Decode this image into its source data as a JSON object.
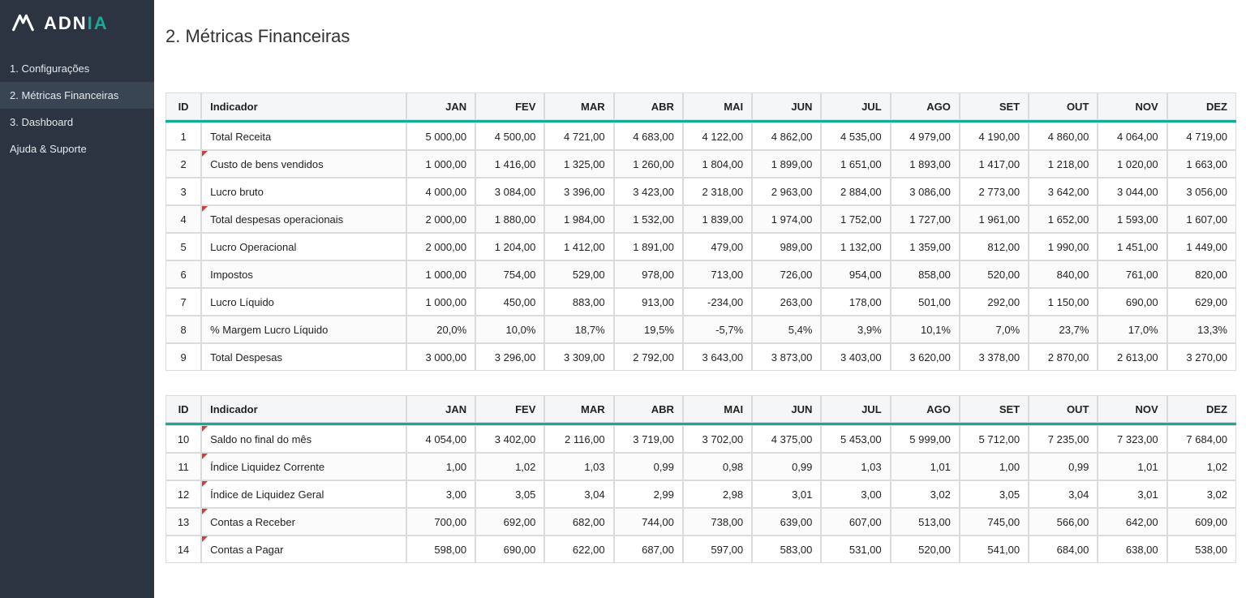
{
  "brand": {
    "name_primary": "ADN",
    "name_accent": "IA"
  },
  "sidebar": {
    "items": [
      {
        "label": "1. Configurações"
      },
      {
        "label": "2. Métricas Financeiras"
      },
      {
        "label": "3. Dashboard"
      },
      {
        "label": "Ajuda & Suporte"
      }
    ],
    "active_index": 1
  },
  "page": {
    "title": "2. Métricas Financeiras"
  },
  "columns": {
    "id": "ID",
    "indicator": "Indicador",
    "months": [
      "JAN",
      "FEV",
      "MAR",
      "ABR",
      "MAI",
      "JUN",
      "JUL",
      "AGO",
      "SET",
      "OUT",
      "NOV",
      "DEZ"
    ]
  },
  "tables": [
    {
      "rows": [
        {
          "id": "1",
          "indicator": "Total Receita",
          "note": false,
          "values": [
            "5 000,00",
            "4 500,00",
            "4 721,00",
            "4 683,00",
            "4 122,00",
            "4 862,00",
            "4 535,00",
            "4 979,00",
            "4 190,00",
            "4 860,00",
            "4 064,00",
            "4 719,00"
          ]
        },
        {
          "id": "2",
          "indicator": "Custo de bens vendidos",
          "note": true,
          "values": [
            "1 000,00",
            "1 416,00",
            "1 325,00",
            "1 260,00",
            "1 804,00",
            "1 899,00",
            "1 651,00",
            "1 893,00",
            "1 417,00",
            "1 218,00",
            "1 020,00",
            "1 663,00"
          ]
        },
        {
          "id": "3",
          "indicator": "Lucro bruto",
          "note": false,
          "values": [
            "4 000,00",
            "3 084,00",
            "3 396,00",
            "3 423,00",
            "2 318,00",
            "2 963,00",
            "2 884,00",
            "3 086,00",
            "2 773,00",
            "3 642,00",
            "3 044,00",
            "3 056,00"
          ]
        },
        {
          "id": "4",
          "indicator": "Total despesas operacionais",
          "note": true,
          "values": [
            "2 000,00",
            "1 880,00",
            "1 984,00",
            "1 532,00",
            "1 839,00",
            "1 974,00",
            "1 752,00",
            "1 727,00",
            "1 961,00",
            "1 652,00",
            "1 593,00",
            "1 607,00"
          ]
        },
        {
          "id": "5",
          "indicator": "Lucro Operacional",
          "note": false,
          "values": [
            "2 000,00",
            "1 204,00",
            "1 412,00",
            "1 891,00",
            "479,00",
            "989,00",
            "1 132,00",
            "1 359,00",
            "812,00",
            "1 990,00",
            "1 451,00",
            "1 449,00"
          ]
        },
        {
          "id": "6",
          "indicator": "Impostos",
          "note": false,
          "values": [
            "1 000,00",
            "754,00",
            "529,00",
            "978,00",
            "713,00",
            "726,00",
            "954,00",
            "858,00",
            "520,00",
            "840,00",
            "761,00",
            "820,00"
          ]
        },
        {
          "id": "7",
          "indicator": "Lucro Líquido",
          "note": false,
          "values": [
            "1 000,00",
            "450,00",
            "883,00",
            "913,00",
            "-234,00",
            "263,00",
            "178,00",
            "501,00",
            "292,00",
            "1 150,00",
            "690,00",
            "629,00"
          ]
        },
        {
          "id": "8",
          "indicator": "% Margem Lucro Líquido",
          "note": false,
          "values": [
            "20,0%",
            "10,0%",
            "18,7%",
            "19,5%",
            "-5,7%",
            "5,4%",
            "3,9%",
            "10,1%",
            "7,0%",
            "23,7%",
            "17,0%",
            "13,3%"
          ]
        },
        {
          "id": "9",
          "indicator": "Total Despesas",
          "note": false,
          "values": [
            "3 000,00",
            "3 296,00",
            "3 309,00",
            "2 792,00",
            "3 643,00",
            "3 873,00",
            "3 403,00",
            "3 620,00",
            "3 378,00",
            "2 870,00",
            "2 613,00",
            "3 270,00"
          ]
        }
      ]
    },
    {
      "rows": [
        {
          "id": "10",
          "indicator": "Saldo no final do mês",
          "note": true,
          "values": [
            "4 054,00",
            "3 402,00",
            "2 116,00",
            "3 719,00",
            "3 702,00",
            "4 375,00",
            "5 453,00",
            "5 999,00",
            "5 712,00",
            "7 235,00",
            "7 323,00",
            "7 684,00"
          ]
        },
        {
          "id": "11",
          "indicator": "Índice Liquidez Corrente",
          "note": true,
          "values": [
            "1,00",
            "1,02",
            "1,03",
            "0,99",
            "0,98",
            "0,99",
            "1,03",
            "1,01",
            "1,00",
            "0,99",
            "1,01",
            "1,02"
          ]
        },
        {
          "id": "12",
          "indicator": "Índice de Liquidez Geral",
          "note": true,
          "values": [
            "3,00",
            "3,05",
            "3,04",
            "2,99",
            "2,98",
            "3,01",
            "3,00",
            "3,02",
            "3,05",
            "3,04",
            "3,01",
            "3,02"
          ]
        },
        {
          "id": "13",
          "indicator": "Contas a Receber",
          "note": true,
          "values": [
            "700,00",
            "692,00",
            "682,00",
            "744,00",
            "738,00",
            "639,00",
            "607,00",
            "513,00",
            "745,00",
            "566,00",
            "642,00",
            "609,00"
          ]
        },
        {
          "id": "14",
          "indicator": "Contas a Pagar",
          "note": true,
          "values": [
            "598,00",
            "690,00",
            "622,00",
            "687,00",
            "597,00",
            "583,00",
            "531,00",
            "520,00",
            "541,00",
            "684,00",
            "638,00",
            "538,00"
          ]
        }
      ]
    }
  ]
}
